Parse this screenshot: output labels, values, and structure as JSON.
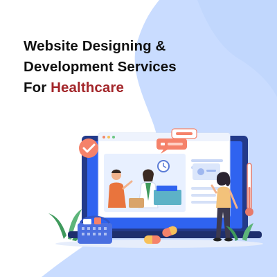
{
  "headline": {
    "line1": "Website Designing &",
    "line2": "Development Services",
    "line3_prefix": "For ",
    "line3_accent": "Healthcare"
  },
  "colors": {
    "accent": "#a3262a",
    "background_blob": "#c9dcff",
    "text": "#111111",
    "screen_blue": "#2f63f0"
  },
  "illustration": {
    "icons": [
      "checkmark-badge-icon",
      "chat-bubble-icon",
      "clock-icon",
      "medicine-basket-icon",
      "pill-capsule-icon",
      "thermometer-icon"
    ],
    "figures": [
      "doctor-figure",
      "patient-figure",
      "woman-figure"
    ]
  }
}
